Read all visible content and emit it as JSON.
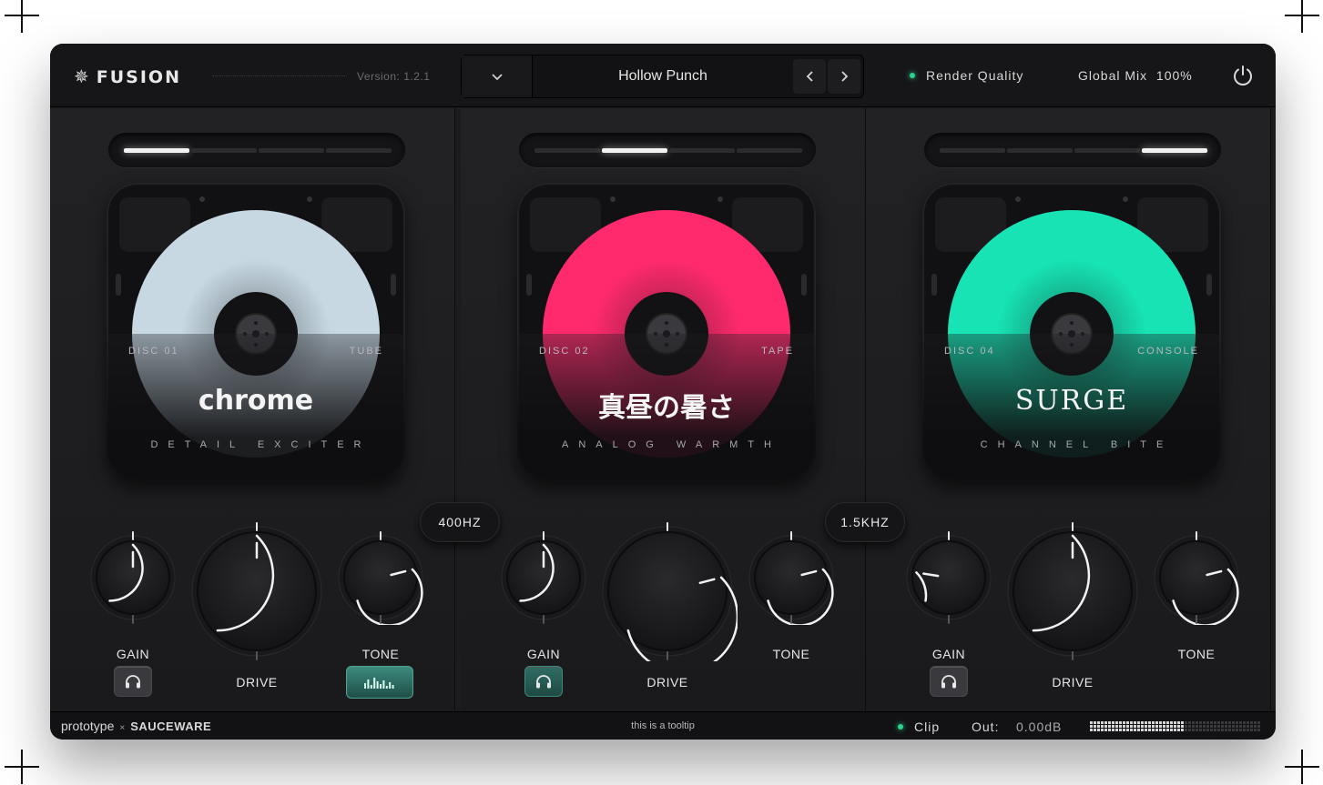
{
  "header": {
    "logo_icon": "asterisk-star-icon",
    "logo_text": "FUSION",
    "version": "Version: 1.2.1",
    "preset": {
      "dropdown_icon": "chevron-down-icon",
      "name": "Hollow Punch",
      "prev_icon": "‹",
      "next_icon": "›"
    },
    "render_quality": "Render Quality",
    "global_mix": "Global Mix  100%",
    "power_icon": "power-icon"
  },
  "panels": [
    {
      "selector_active_index": 0,
      "disc_number": "DISC 01",
      "disc_type": "TUBE",
      "title": "chrome",
      "subtitle": "DETAIL EXCITER",
      "disc_color": "#c7d8e3",
      "knobs": {
        "gain": {
          "label": "GAIN",
          "value": 0.5
        },
        "drive": {
          "label": "DRIVE",
          "value": 0.5
        },
        "tone": {
          "label": "TONE",
          "value": 0.78
        }
      },
      "gain_button": {
        "icon": "headphones-icon",
        "active": false
      },
      "tone_button": {
        "icon": "spectrum-meter-icon",
        "active": true
      }
    },
    {
      "selector_active_index": 1,
      "disc_number": "DISC 02",
      "disc_type": "TAPE",
      "title": "真昼の暑さ",
      "subtitle": "ANALOG WARMTH",
      "disc_color": "#ff2a6d",
      "knobs": {
        "gain": {
          "label": "GAIN",
          "value": 0.5
        },
        "drive": {
          "label": "DRIVE",
          "value": 0.78
        },
        "tone": {
          "label": "TONE",
          "value": 0.78
        }
      },
      "gain_button": {
        "icon": "headphones-icon",
        "active": true
      }
    },
    {
      "selector_active_index": 3,
      "disc_number": "DISC 04",
      "disc_type": "CONSOLE",
      "title": "SURGE",
      "subtitle": "CHANNEL BITE",
      "disc_color": "#17e3b4",
      "knobs": {
        "gain": {
          "label": "GAIN",
          "value": 0.2
        },
        "drive": {
          "label": "DRIVE",
          "value": 0.5
        },
        "tone": {
          "label": "TONE",
          "value": 0.78
        }
      },
      "gain_button": {
        "icon": "headphones-icon",
        "active": false
      }
    }
  ],
  "crossovers": [
    {
      "label": "400HZ"
    },
    {
      "label": "1.5KHZ"
    }
  ],
  "footer": {
    "brand_left": "prototype",
    "brand_x": "×",
    "brand_right": "SAUCEWARE",
    "tooltip": "this is a tooltip",
    "clip": "Clip",
    "out_label": "Out:",
    "out_value": "0.00dB",
    "out_meter_level": 0.55
  },
  "colors": {
    "accent_green": "#2bd18f",
    "background": "#1c1c1e"
  }
}
